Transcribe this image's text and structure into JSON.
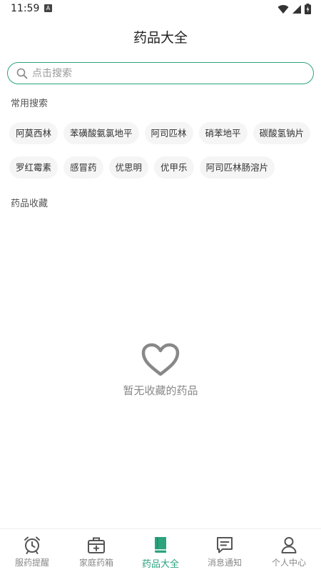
{
  "status_bar": {
    "time": "11:59",
    "notification_badge": "A"
  },
  "header": {
    "title": "药品大全"
  },
  "search": {
    "placeholder": "点击搜索",
    "value": ""
  },
  "common_search": {
    "label": "常用搜索",
    "row1": [
      "阿莫西林",
      "苯磺酸氨氯地平",
      "阿司匹林",
      "硝苯地平",
      "碳酸氢钠片"
    ],
    "row2": [
      "罗红霉素",
      "感冒药",
      "优思明",
      "优甲乐",
      "阿司匹林肠溶片"
    ]
  },
  "favorites": {
    "label": "药品收藏",
    "empty_text": "暂无收藏的药品"
  },
  "bottom_nav": {
    "items": [
      {
        "label": "服药提醒",
        "icon": "alarm-clock-icon"
      },
      {
        "label": "家庭药箱",
        "icon": "medicine-box-icon"
      },
      {
        "label": "药品大全",
        "icon": "book-icon"
      },
      {
        "label": "消息通知",
        "icon": "message-icon"
      },
      {
        "label": "个人中心",
        "icon": "user-icon"
      }
    ],
    "active_index": 2
  },
  "colors": {
    "accent": "#2aa37e",
    "icon_gray": "#555555",
    "empty_gray": "#888888"
  }
}
